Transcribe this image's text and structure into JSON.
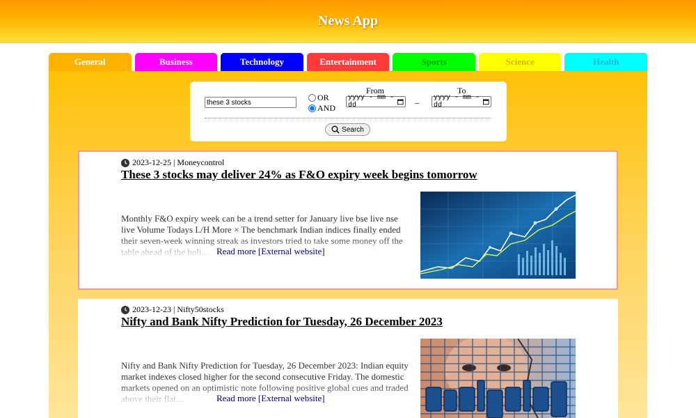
{
  "app": {
    "title": "News App"
  },
  "tabs": [
    {
      "label": "General",
      "bg": "#ffb300",
      "color": "#ffffff"
    },
    {
      "label": "Business",
      "bg": "#ff00ff",
      "color": "#ffffff"
    },
    {
      "label": "Technology",
      "bg": "#0000ff",
      "color": "#ffffff"
    },
    {
      "label": "Entertainment",
      "bg": "#ff3b3b",
      "color": "#ffffff"
    },
    {
      "label": "Sports",
      "bg": "#00ff00",
      "color": "#00a000"
    },
    {
      "label": "Science",
      "bg": "#ffff00",
      "color": "#e0b000"
    },
    {
      "label": "Health",
      "bg": "#00ffff",
      "color": "#20b8d8"
    }
  ],
  "search": {
    "keyword_value": "these 3 stocks",
    "or_label": "OR",
    "and_label": "AND",
    "selected_mode": "AND",
    "from_label": "From",
    "to_label": "To",
    "date_placeholder": "yyyy - mm - dd",
    "dash": "–",
    "button_label": "Search",
    "button_icon": "search-icon"
  },
  "articles": [
    {
      "date": "2023-12-25",
      "separator": "|",
      "source": "Moneycontrol",
      "title": "These 3 stocks may deliver 24% as F&O expiry week begins tomorrow",
      "description": "Monthly F&O expiry week can be a trend setter for January live bse live nse live Volume Todays L/H More × The benchmark Indian indices finally ended their seven-week winning streak as investors tried to take some money off the table ahead of the holi....",
      "read_more": "Read more [External website]",
      "image_icon": "stock-chart-image"
    },
    {
      "date": "2023-12-23",
      "separator": "|",
      "source": "Nifty50stocks",
      "title": "Nifty and Bank Nifty Prediction for Tuesday, 26 December 2023",
      "description": "Nifty and Bank Nifty Prediction for Tuesday, 26 December 2023: Indian equity market indexes closed higher for the second consecutive Friday. The domestic markets opened on an optimistic note following positive global cues and traded above their flat....",
      "read_more": "Read more [External website]",
      "image_icon": "analysis-image"
    }
  ]
}
